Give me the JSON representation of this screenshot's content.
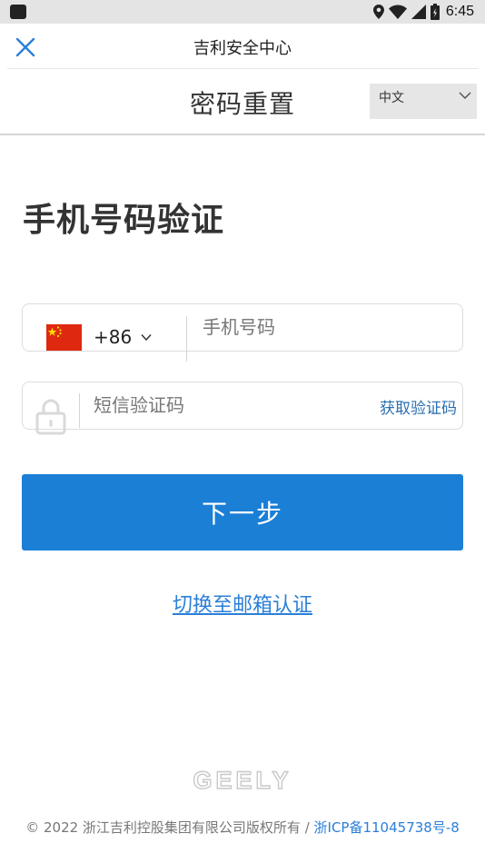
{
  "status_bar": {
    "time": "6:45"
  },
  "topbar": {
    "title": "吉利安全中心"
  },
  "header": {
    "title": "密码重置",
    "language": "中文"
  },
  "section_title": "手机号码验证",
  "phone_field": {
    "country_code": "+86",
    "placeholder": "手机号码",
    "value": ""
  },
  "sms_field": {
    "placeholder": "短信验证码",
    "value": "",
    "get_code_label": "获取验证码"
  },
  "next_button": {
    "label": "下一步"
  },
  "switch_link": {
    "label": "切换至邮箱认证"
  },
  "brand": {
    "logo_text": "GEELY"
  },
  "footer": {
    "copyright": "© 2022 浙江吉利控股集团有限公司版权所有 / ",
    "icp": "浙ICP备11045738号-8"
  },
  "colors": {
    "primary": "#1b7fd6",
    "link": "#2b7fd8",
    "status_bar": "#e4e4e4",
    "lang_bg": "#e6e6e6"
  }
}
